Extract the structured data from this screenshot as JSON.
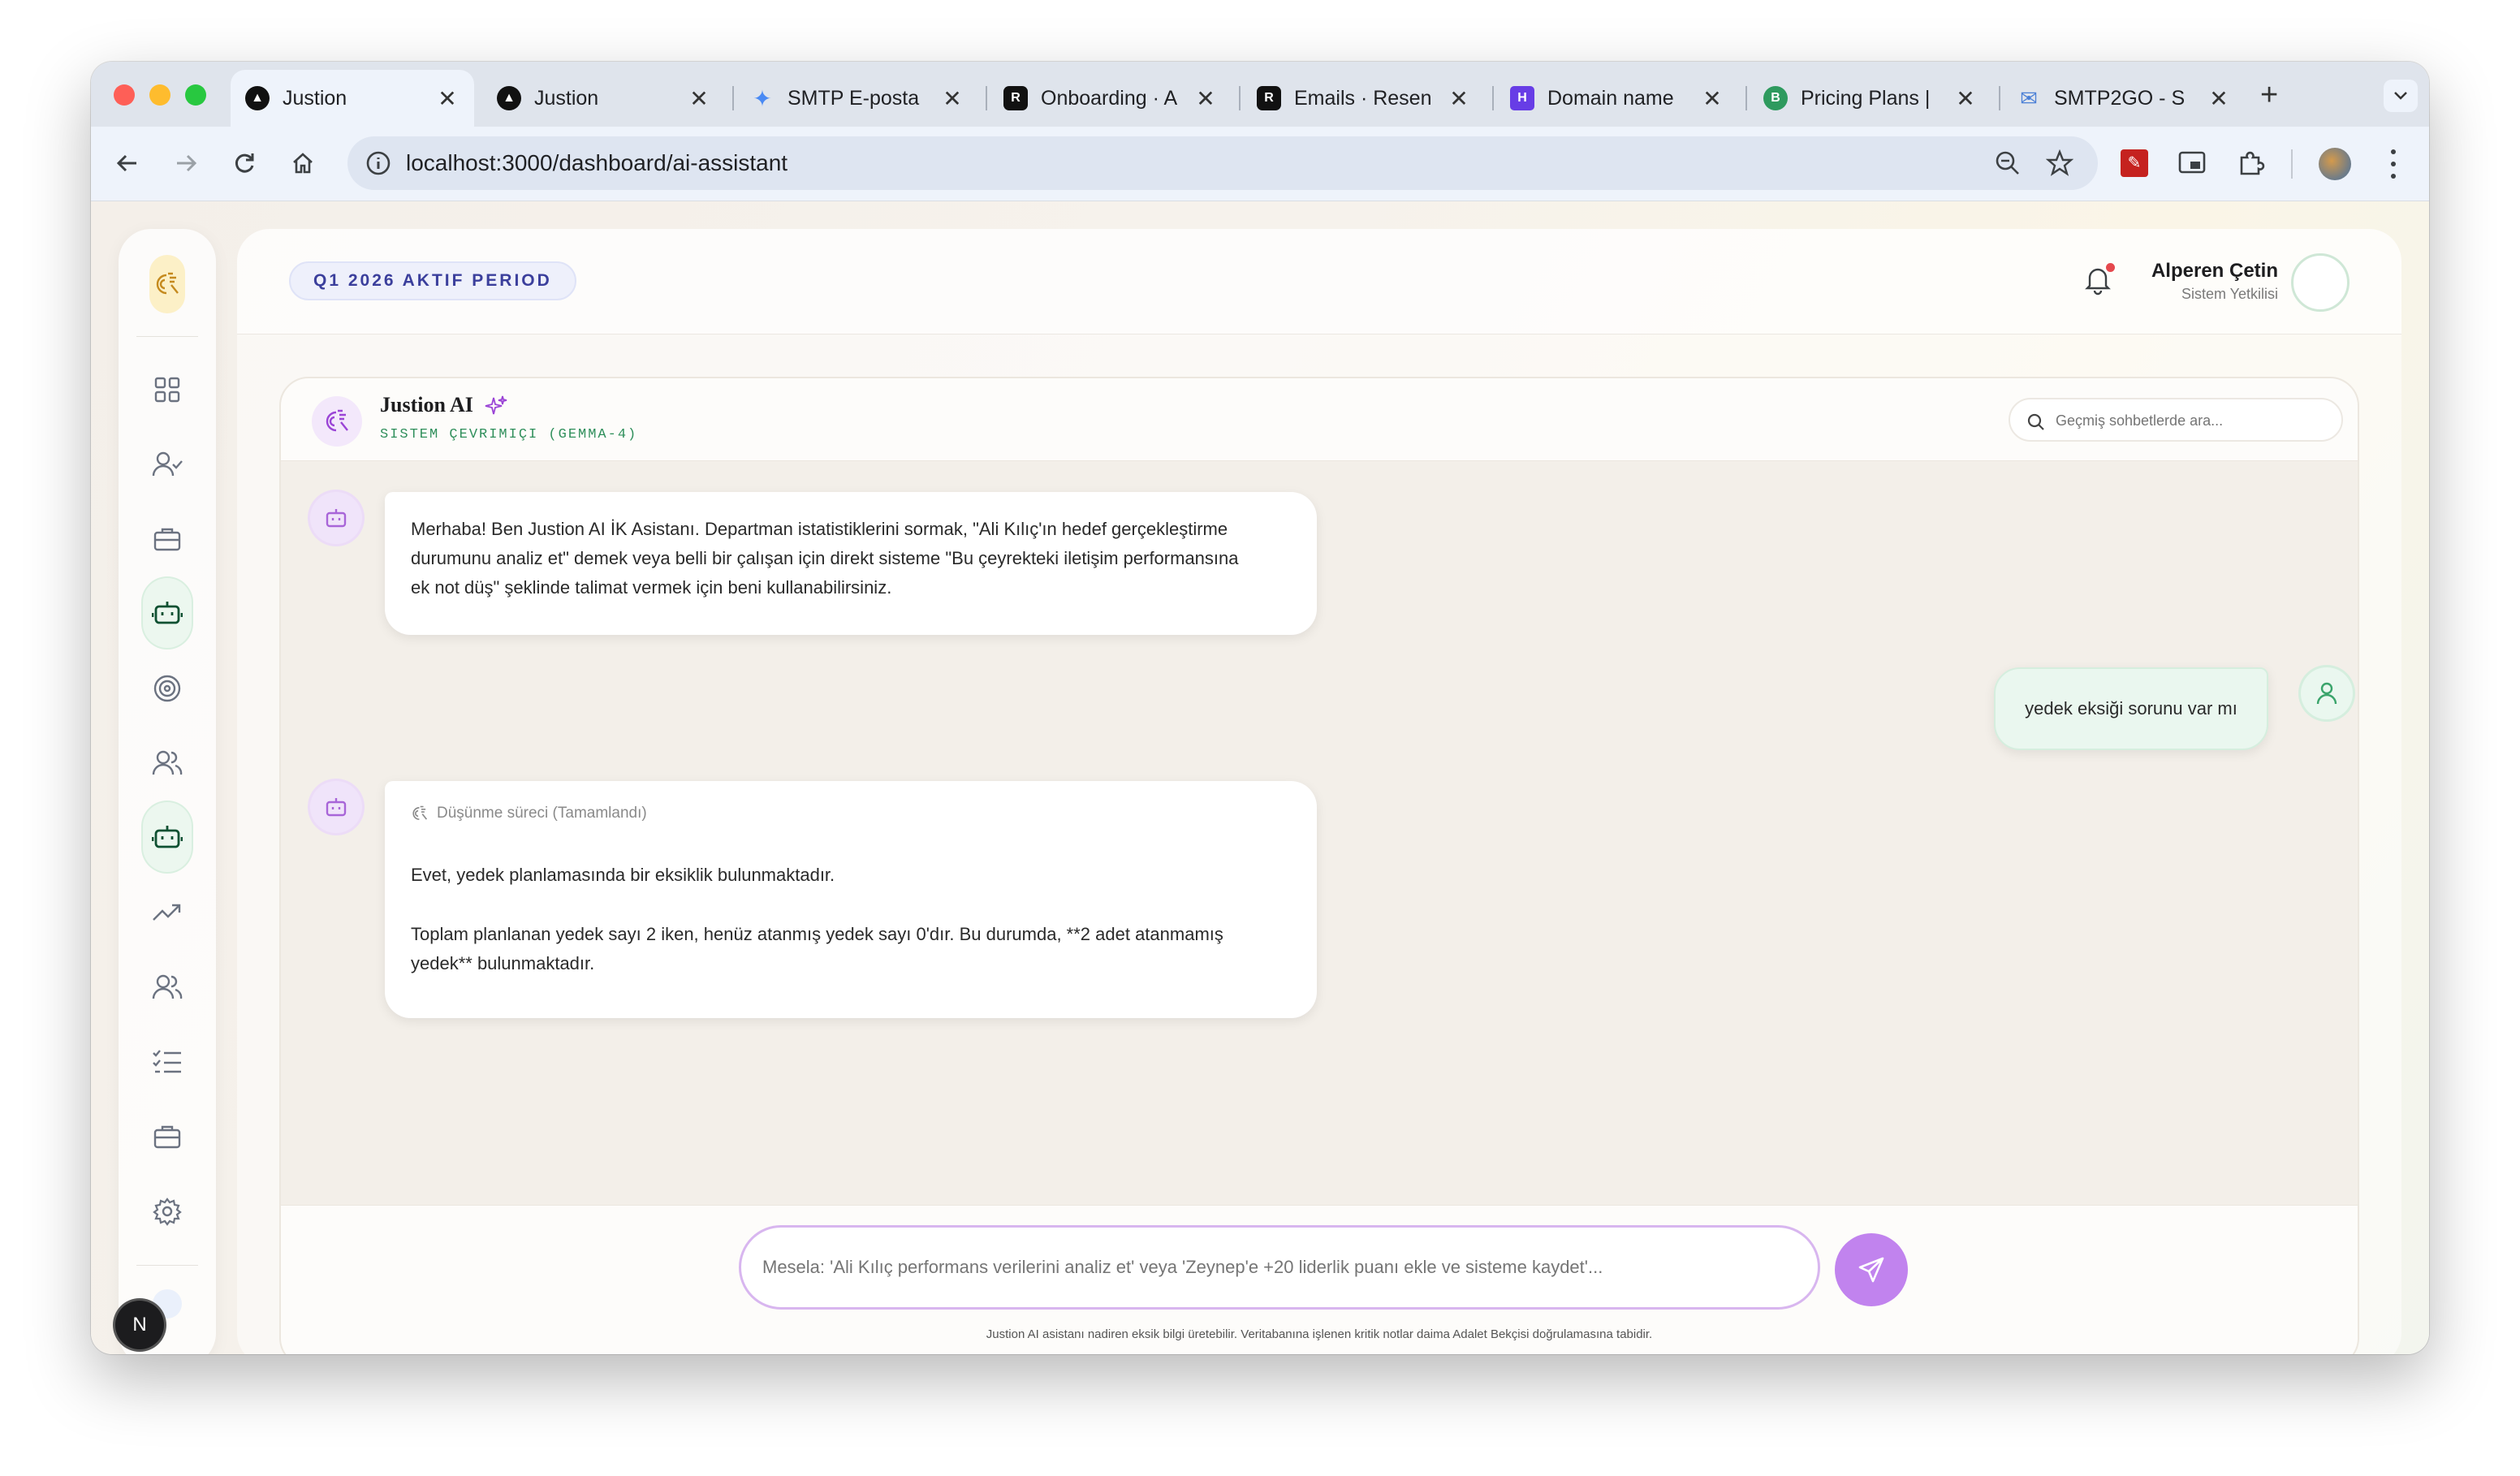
{
  "browser": {
    "tabs": [
      {
        "title": "Justion",
        "icon": "triangle-logo-icon"
      },
      {
        "title": "Justion",
        "icon": "triangle-logo-icon"
      },
      {
        "title": "SMTP E-posta",
        "icon": "sparkle-icon"
      },
      {
        "title": "Onboarding · A",
        "icon": "resend-icon"
      },
      {
        "title": "Emails · Resen",
        "icon": "resend-icon"
      },
      {
        "title": "Domain name",
        "icon": "hostinger-icon"
      },
      {
        "title": "Pricing Plans |",
        "icon": "b-logo-icon"
      },
      {
        "title": "SMTP2GO - S",
        "icon": "mail-icon"
      }
    ],
    "url": "localhost:3000/dashboard/ai-assistant"
  },
  "header": {
    "period": "Q1 2026 AKTIF PERIOD",
    "user_name": "Alperen Çetin",
    "user_role": "Sistem Yetkilisi"
  },
  "chat": {
    "title": "Justion AI",
    "status": "SISTEM ÇEVRIMIÇI (GEMMA-4)",
    "search_placeholder": "Geçmiş sohbetlerde ara...",
    "messages": [
      {
        "role": "assistant",
        "lines": [
          "Merhaba! Ben Justion AI İK Asistanı. Departman istatistiklerini sormak, \"Ali Kılıç'ın hedef gerçekleştirme",
          "durumunu analiz et\" demek veya belli bir çalışan için direkt sisteme \"Bu çeyrekteki iletişim performansına",
          "ek not düş\" şeklinde talimat vermek için beni kullanabilirsiniz."
        ]
      },
      {
        "role": "user",
        "text": "yedek eksiği sorunu var mı"
      },
      {
        "role": "assistant",
        "thinking": "Düşünme süreci (Tamamlandı)",
        "lines": [
          "Evet, yedek planlamasında bir eksiklik bulunmaktadır.",
          "Toplam planlanan yedek sayı 2 iken, henüz atanmış yedek sayı 0'dır. Bu durumda, **2 adet atanmamış",
          "yedek** bulunmaktadır."
        ]
      }
    ],
    "input_placeholder": "Mesela: 'Ali Kılıç performans verilerini analiz et' veya 'Zeynep'e +20 liderlik puanı ekle ve sisteme kaydet'...",
    "disclaimer": "Justion AI asistanı nadiren eksik bilgi üretebilir. Veritabanına işlenen kritik notlar daima Adalet Bekçisi doğrulamasına tabidir."
  },
  "floating_badge": "N",
  "colors": {
    "accent_purple": "#c183ee",
    "status_green": "#2f8f5b",
    "period_text": "#3b3f9c"
  }
}
